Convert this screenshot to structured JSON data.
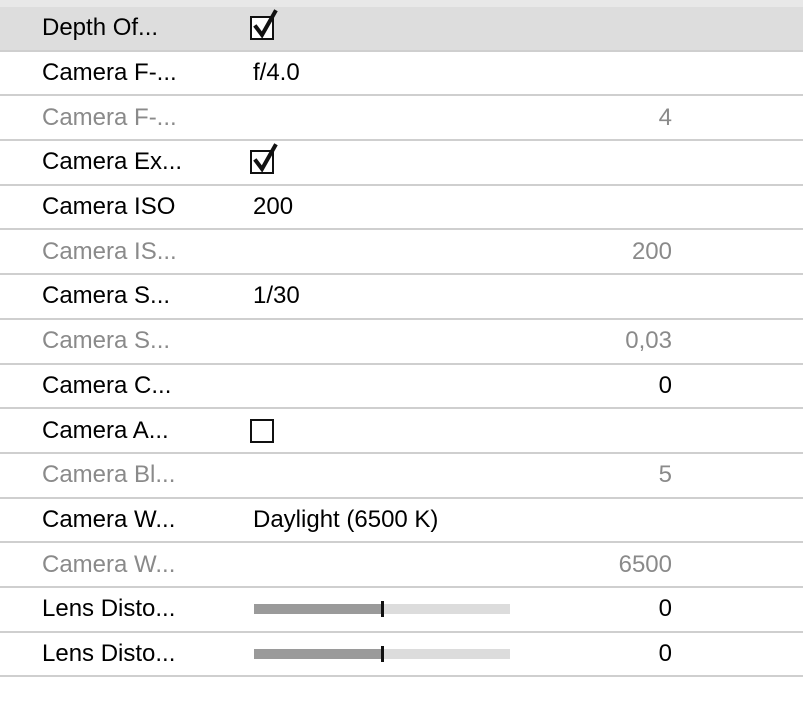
{
  "rows": [
    {
      "label": "Depth Of...",
      "kind": "checkbox",
      "checked": true,
      "selected": true
    },
    {
      "label": "Camera F-...",
      "kind": "text",
      "value": "f/4.0"
    },
    {
      "label": "Camera F-...",
      "kind": "number",
      "value": "4",
      "disabled": true
    },
    {
      "label": "Camera Ex...",
      "kind": "checkbox",
      "checked": true
    },
    {
      "label": "Camera ISO",
      "kind": "text",
      "value": "200"
    },
    {
      "label": "Camera IS...",
      "kind": "number",
      "value": "200",
      "disabled": true
    },
    {
      "label": "Camera S...",
      "kind": "text",
      "value": "1/30"
    },
    {
      "label": "Camera S...",
      "kind": "number",
      "value": "0,03",
      "disabled": true
    },
    {
      "label": "Camera C...",
      "kind": "number",
      "value": "0"
    },
    {
      "label": "Camera A...",
      "kind": "checkbox",
      "checked": false
    },
    {
      "label": "Camera Bl...",
      "kind": "number",
      "value": "5",
      "disabled": true
    },
    {
      "label": "Camera W...",
      "kind": "text",
      "value": "Daylight (6500 K)"
    },
    {
      "label": "Camera W...",
      "kind": "number",
      "value": "6500",
      "disabled": true
    },
    {
      "label": "Lens Disto...",
      "kind": "slider",
      "fraction": 0.5,
      "value": "0"
    },
    {
      "label": "Lens Disto...",
      "kind": "slider",
      "fraction": 0.5,
      "value": "0"
    }
  ]
}
